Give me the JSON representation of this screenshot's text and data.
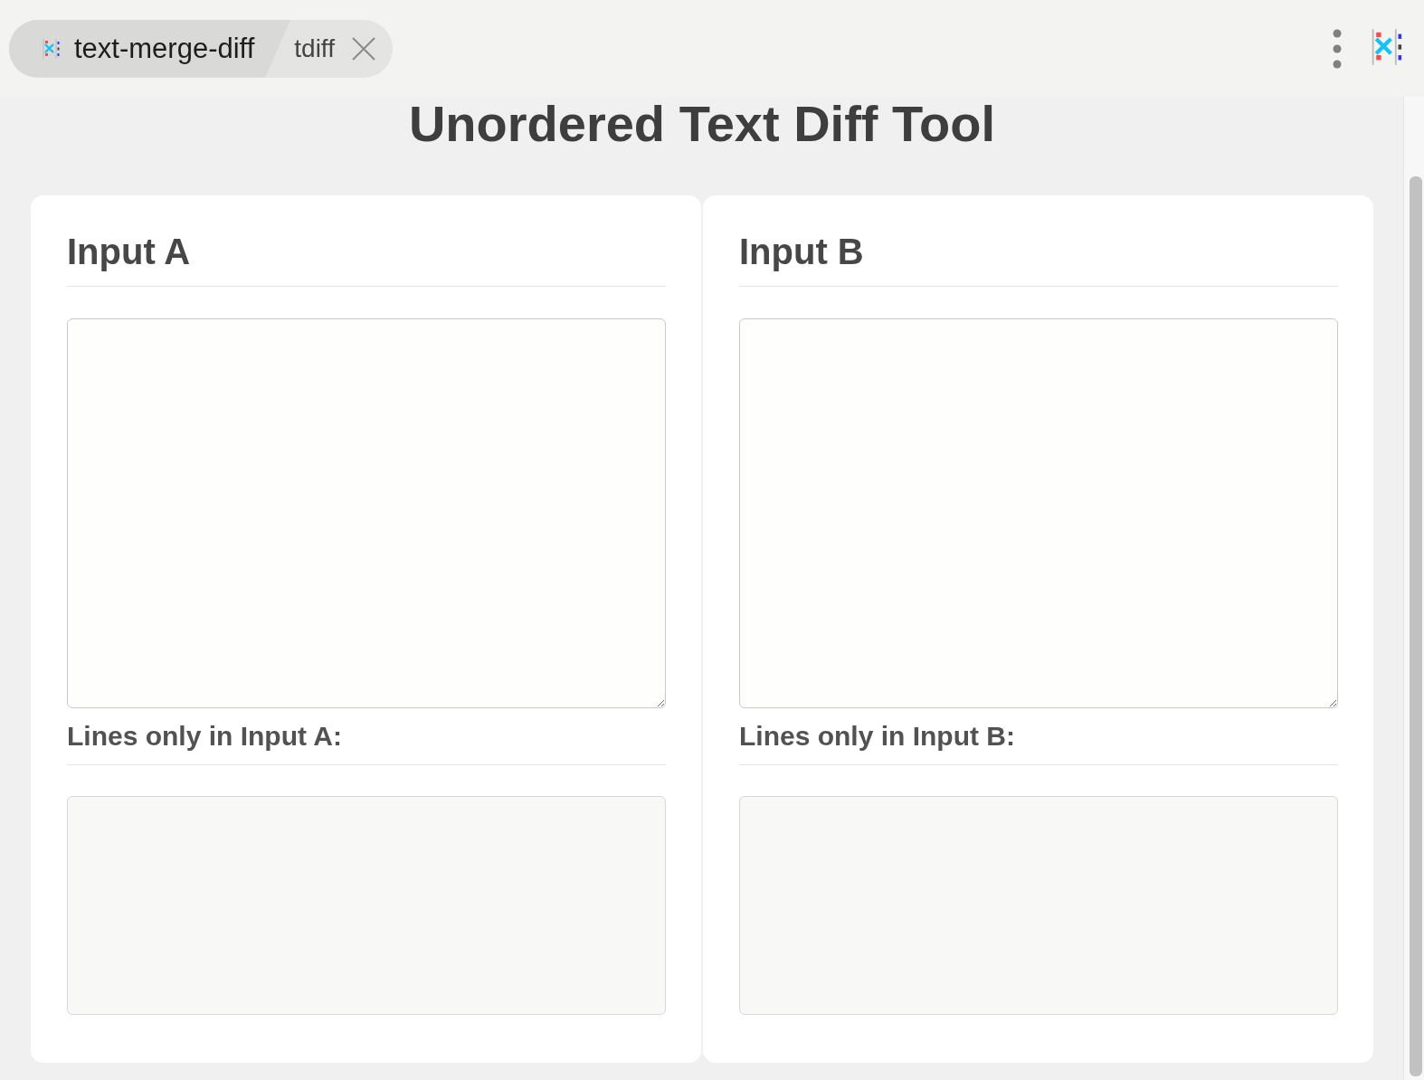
{
  "tab": {
    "app_name": "text-merge-diff",
    "title": "tdiff"
  },
  "page": {
    "title": "Unordered Text Diff Tool"
  },
  "panels": [
    {
      "heading": "Input A",
      "result_label": "Lines only in Input A:"
    },
    {
      "heading": "Input B",
      "result_label": "Lines only in Input B:"
    }
  ]
}
